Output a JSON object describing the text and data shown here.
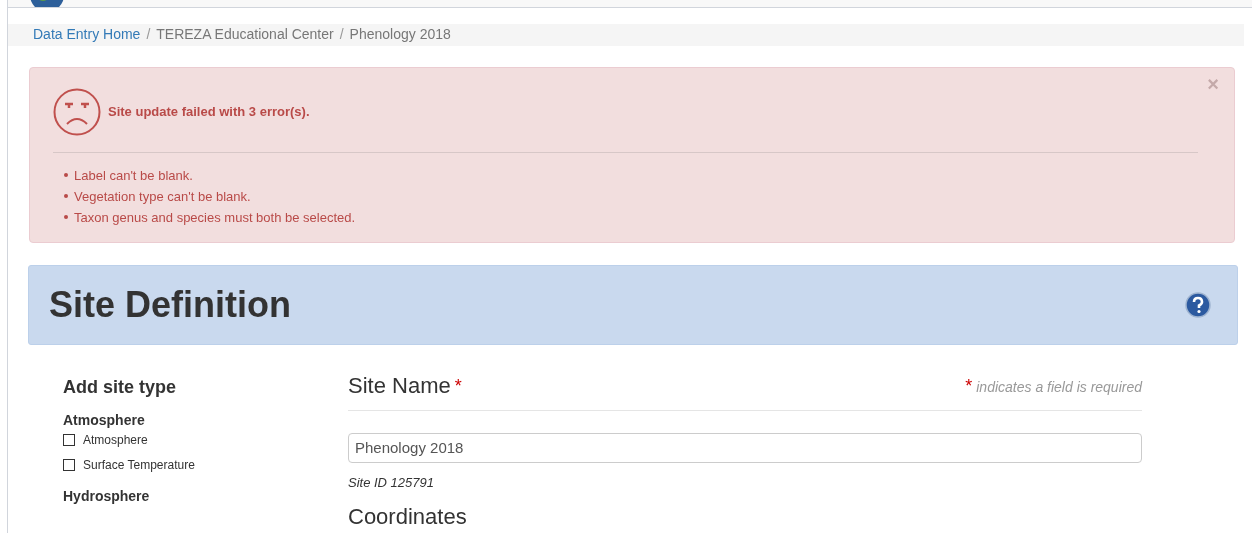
{
  "breadcrumb_separator": "/",
  "breadcrumb": [
    {
      "label": "Data Entry Home",
      "kind": "link"
    },
    {
      "label": "TEREZA Educational Center",
      "kind": "text"
    },
    {
      "label": "Phenology 2018",
      "kind": "text"
    }
  ],
  "alert": {
    "title": "Site update failed with 3 error(s).",
    "close": "×",
    "errors": [
      "Label can't be blank.",
      "Vegetation type can't be blank.",
      "Taxon genus and species must both be selected."
    ]
  },
  "panel": {
    "title": "Site Definition"
  },
  "site_types": {
    "heading": "Add site type",
    "groups": [
      {
        "name": "Atmosphere",
        "options": [
          {
            "label": "Atmosphere",
            "checked": false
          },
          {
            "label": "Surface Temperature",
            "checked": false
          }
        ]
      },
      {
        "name": "Hydrosphere"
      }
    ]
  },
  "form": {
    "site_name_label": "Site Name",
    "required_mark": "*",
    "required_note": "indicates a field is required",
    "site_name_value": "Phenology 2018",
    "site_id": "Site ID 125791",
    "next_heading": "Coordinates"
  }
}
